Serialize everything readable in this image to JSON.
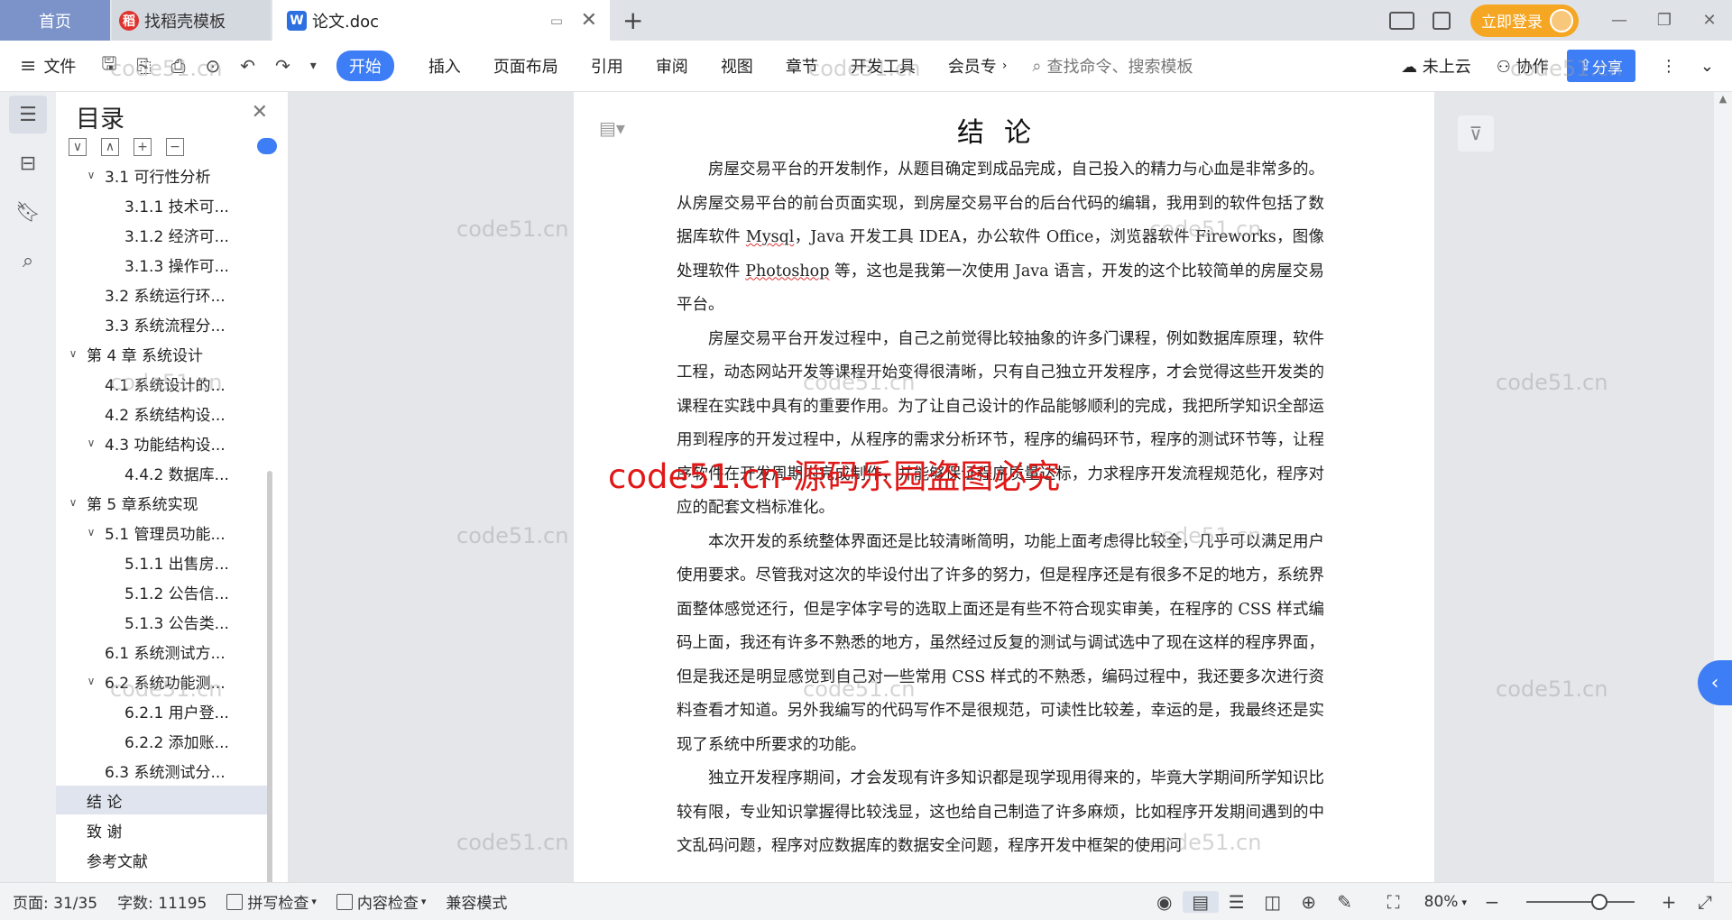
{
  "tabs": {
    "home": "首页",
    "template": "找稻壳模板",
    "doc": "论文.doc"
  },
  "titlebar": {
    "login": "立即登录"
  },
  "ribbon": {
    "file": "文件",
    "tabs": [
      "开始",
      "插入",
      "页面布局",
      "引用",
      "审阅",
      "视图",
      "章节",
      "开发工具",
      "会员专"
    ],
    "search_placeholder": "查找命令、搜索模板",
    "cloud": "未上云",
    "collab": "协作",
    "share": "分享"
  },
  "toc": {
    "title": "目录",
    "items": [
      {
        "label": "3.1 可行性分析",
        "level": 2,
        "arrow": "∨"
      },
      {
        "label": "3.1.1 技术可...",
        "level": 3,
        "arrow": ""
      },
      {
        "label": "3.1.2 经济可...",
        "level": 3,
        "arrow": ""
      },
      {
        "label": "3.1.3 操作可...",
        "level": 3,
        "arrow": ""
      },
      {
        "label": "3.2 系统运行环...",
        "level": 2,
        "arrow": ""
      },
      {
        "label": "3.3 系统流程分...",
        "level": 2,
        "arrow": ""
      },
      {
        "label": "第 4 章  系统设计",
        "level": 1,
        "arrow": "∨"
      },
      {
        "label": "4.1  系统设计的...",
        "level": 2,
        "arrow": ""
      },
      {
        "label": "4.2  系统结构设...",
        "level": 2,
        "arrow": ""
      },
      {
        "label": "4.3 功能结构设...",
        "level": 2,
        "arrow": "∨"
      },
      {
        "label": "4.4.2  数据库...",
        "level": 3,
        "arrow": ""
      },
      {
        "label": "第 5 章系统实现",
        "level": 1,
        "arrow": "∨"
      },
      {
        "label": "5.1 管理员功能...",
        "level": 2,
        "arrow": "∨"
      },
      {
        "label": "5.1.1  出售房...",
        "level": 3,
        "arrow": ""
      },
      {
        "label": "5.1.2  公告信...",
        "level": 3,
        "arrow": ""
      },
      {
        "label": "5.1.3 公告类...",
        "level": 3,
        "arrow": ""
      },
      {
        "label": "6.1 系统测试方...",
        "level": 2,
        "arrow": ""
      },
      {
        "label": "6.2  系统功能测...",
        "level": 2,
        "arrow": "∨"
      },
      {
        "label": "6.2.1  用户登...",
        "level": 3,
        "arrow": ""
      },
      {
        "label": "6.2.2  添加账...",
        "level": 3,
        "arrow": ""
      },
      {
        "label": "6.3  系统测试分...",
        "level": 2,
        "arrow": ""
      },
      {
        "label": "结  论",
        "level": 1,
        "arrow": "",
        "selected": true
      },
      {
        "label": "致  谢",
        "level": 1,
        "arrow": ""
      },
      {
        "label": "参考文献",
        "level": 1,
        "arrow": ""
      }
    ]
  },
  "document": {
    "title": "结论",
    "p1": [
      "房屋交易平台的开发制作，从题目确定到成品完成，自己投入的精力与心血是非常多的。从房屋交易平台的前台页面实现，到房屋交易平台的后台代码的编辑，我用到的软件包括了数据库软件 ",
      "Mysql",
      "，Java 开发工具 IDEA，办公软件 Office，浏览器软件 Fireworks，图像处理软件 ",
      "Photoshop",
      " 等，这也是我第一次使用 Java 语言，开发的这个比较简单的房屋交易平台。"
    ],
    "p2": "房屋交易平台开发过程中，自己之前觉得比较抽象的许多门课程，例如数据库原理，软件工程，动态网站开发等课程开始变得很清晰，只有自己独立开发程序，才会觉得这些开发类的课程在实践中具有的重要作用。为了让自己设计的作品能够顺利的完成，我把所学知识全部运用到程序的开发过程中，从程序的需求分析环节，程序的编码环节，程序的测试环节等，让程序软件在开发周期内完成制作，并能够保证程序质量达标，力求程序开发流程规范化，程序对应的配套文档标准化。",
    "p3": "本次开发的系统整体界面还是比较清晰简明，功能上面考虑得比较全，几乎可以满足用户使用要求。尽管我对这次的毕设付出了许多的努力，但是程序还是有很多不足的地方，系统界面整体感觉还行，但是字体字号的选取上面还是有些不符合现实审美，在程序的 CSS 样式编码上面，我还有许多不熟悉的地方，虽然经过反复的测试与调试选中了现在这样的程序界面，但是我还是明显感觉到自己对一些常用 CSS 样式的不熟悉，编码过程中，我还要多次进行资料查看才知道。另外我编写的代码写作不是很规范，可读性比较差，幸运的是，我最终还是实现了系统中所要求的功能。",
    "p4": "独立开发程序期间，才会发现有许多知识都是现学现用得来的，毕竟大学期间所学知识比较有限，专业知识掌握得比较浅显，这也给自己制造了许多麻烦，比如程序开发期间遇到的中文乱码问题，程序对应数据库的数据安全问题，程序开发中框架的使用问"
  },
  "watermarks": {
    "small": "code51.cn",
    "big": "code51.cn-源码乐园盗图必究"
  },
  "status": {
    "page": "页面: 31/35",
    "words": "字数: 11195",
    "spell": "拼写检查",
    "content": "内容检查",
    "compat": "兼容模式",
    "zoom": "80%"
  }
}
